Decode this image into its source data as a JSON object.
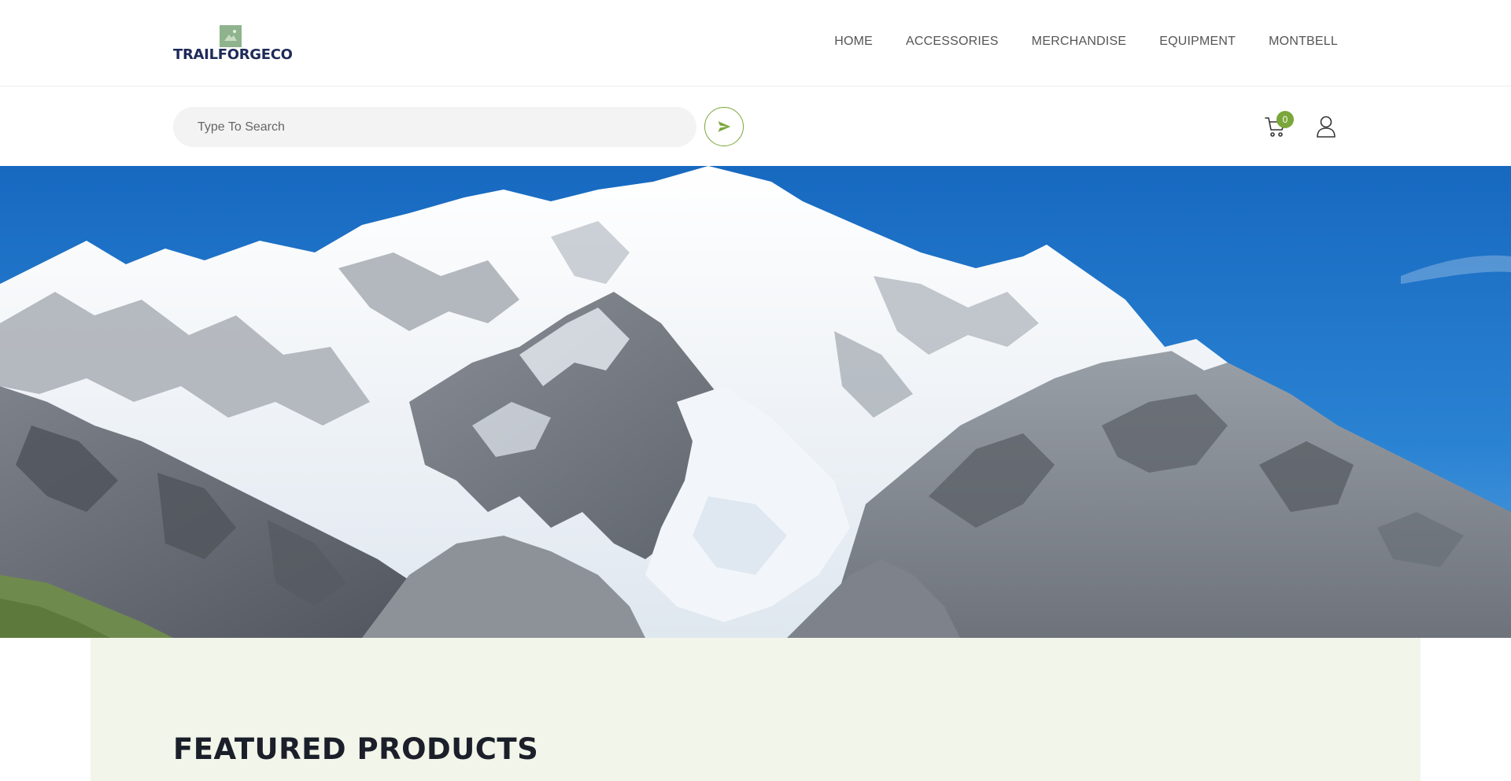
{
  "header": {
    "logo_text": "TRAILFORGECO",
    "nav": [
      {
        "label": "HOME"
      },
      {
        "label": "ACCESSORIES"
      },
      {
        "label": "MERCHANDISE"
      },
      {
        "label": "EQUIPMENT"
      },
      {
        "label": "MONTBELL"
      }
    ]
  },
  "search": {
    "placeholder": "Type To Search",
    "submit_icon": "paper-plane-icon"
  },
  "cart": {
    "icon": "cart-icon",
    "count": "0"
  },
  "account": {
    "icon": "user-icon"
  },
  "hero": {
    "image": "snow-capped-mountain-range",
    "colors": {
      "sky": "#1e74c6",
      "snow": "#eef3f8",
      "rock": "#8c8f95"
    }
  },
  "featured": {
    "title": "FEATURED PRODUCTS"
  },
  "colors": {
    "accent": "#7aa63a",
    "logo_text": "#1f2a5a",
    "section_bg": "#f2f5e9"
  }
}
